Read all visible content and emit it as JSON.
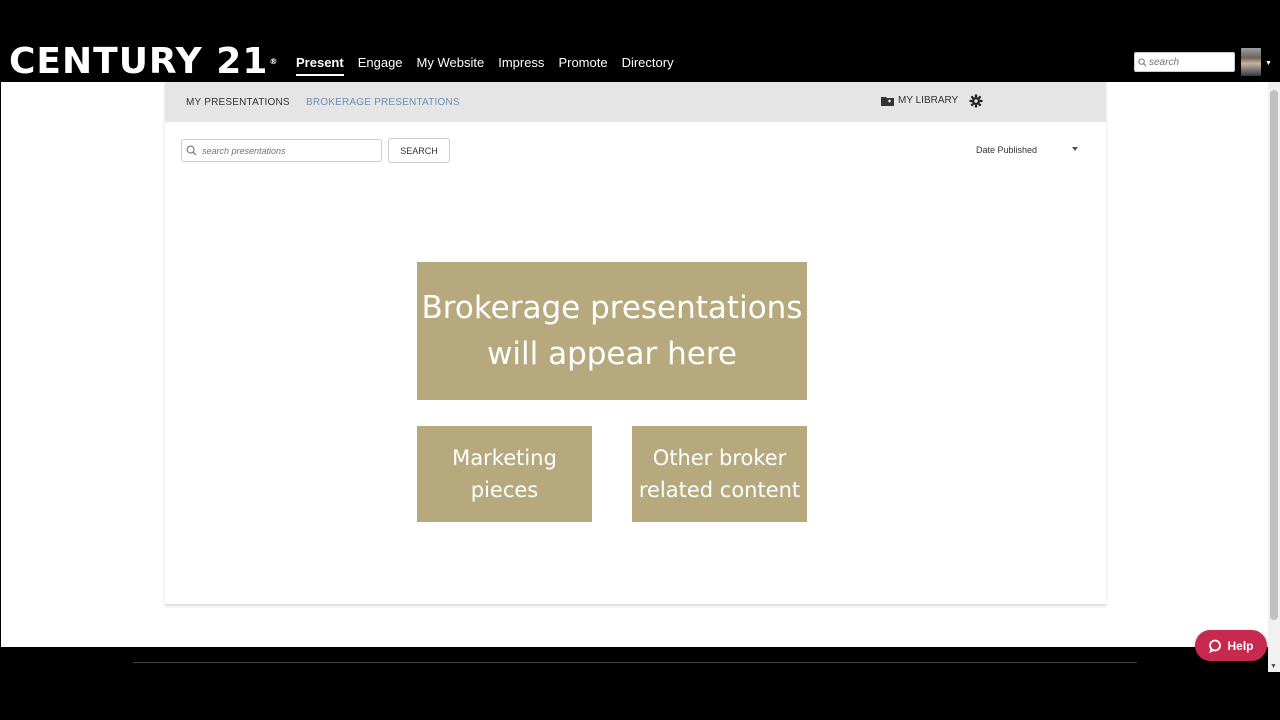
{
  "brand": {
    "name": "CENTURY 21",
    "mark": "®"
  },
  "nav": {
    "items": [
      {
        "label": "Present",
        "active": true
      },
      {
        "label": "Engage"
      },
      {
        "label": "My Website"
      },
      {
        "label": "Impress"
      },
      {
        "label": "Promote"
      },
      {
        "label": "Directory"
      }
    ]
  },
  "header_search": {
    "placeholder": "search"
  },
  "tabs": {
    "my_presentations": "MY PRESENTATIONS",
    "brokerage_presentations": "BROKERAGE PRESENTATIONS"
  },
  "library": {
    "label": "MY LIBRARY",
    "icon": "folder-icon"
  },
  "settings": {
    "icon": "gear-icon"
  },
  "presentation_search": {
    "placeholder": "search presentations",
    "button_label": "SEARCH"
  },
  "sort": {
    "selected": "Date Published"
  },
  "placeholders": {
    "main": "Brokerage presentations will appear here",
    "left": "Marketing pieces",
    "right": "Other broker related content"
  },
  "help": {
    "label": "Help"
  },
  "colors": {
    "accent_link": "#6b8fb5",
    "placeholder_tile": "#b7a97e",
    "help_button": "#c8294e",
    "topbar": "#000000"
  }
}
